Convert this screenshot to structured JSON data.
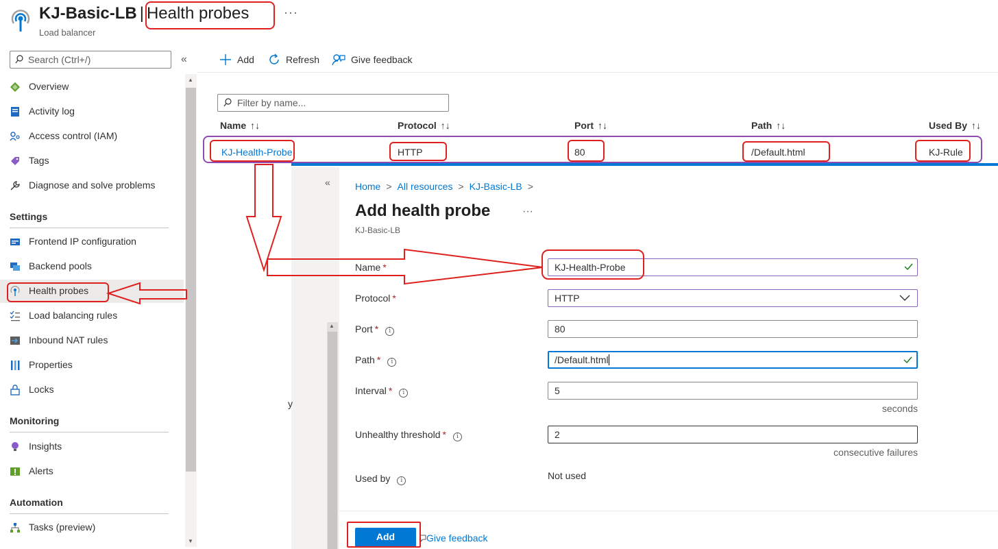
{
  "header": {
    "resource_name": "KJ-Basic-LB",
    "separator": "|",
    "page_name": "Health probes",
    "resource_type": "Load balancer",
    "more": "···"
  },
  "nav": {
    "search_placeholder": "Search (Ctrl+/)",
    "collapse": "«",
    "items": [
      {
        "label": "Overview",
        "icon": "overview-icon"
      },
      {
        "label": "Activity log",
        "icon": "activity-log-icon"
      },
      {
        "label": "Access control (IAM)",
        "icon": "iam-icon"
      },
      {
        "label": "Tags",
        "icon": "tag-icon"
      },
      {
        "label": "Diagnose and solve problems",
        "icon": "wrench-icon"
      }
    ],
    "settings_header": "Settings",
    "settings_items": [
      {
        "label": "Frontend IP configuration",
        "icon": "frontend-ip-icon"
      },
      {
        "label": "Backend pools",
        "icon": "backend-pool-icon"
      },
      {
        "label": "Health probes",
        "icon": "health-probe-icon",
        "selected": true
      },
      {
        "label": "Load balancing rules",
        "icon": "lb-rules-icon"
      },
      {
        "label": "Inbound NAT rules",
        "icon": "nat-rules-icon"
      },
      {
        "label": "Properties",
        "icon": "properties-icon"
      },
      {
        "label": "Locks",
        "icon": "lock-icon"
      }
    ],
    "monitoring_header": "Monitoring",
    "monitoring_items": [
      {
        "label": "Insights",
        "icon": "insights-icon"
      },
      {
        "label": "Alerts",
        "icon": "alerts-icon"
      }
    ],
    "automation_header": "Automation",
    "automation_items": [
      {
        "label": "Tasks (preview)",
        "icon": "tasks-icon"
      }
    ]
  },
  "toolbar": {
    "add": "Add",
    "refresh": "Refresh",
    "feedback": "Give feedback"
  },
  "table": {
    "filter_placeholder": "Filter by name...",
    "sort_glyph": "↑↓",
    "columns": [
      "Name",
      "Protocol",
      "Port",
      "Path",
      "Used By"
    ],
    "rows": [
      {
        "name": "KJ-Health-Probe",
        "protocol": "HTTP",
        "port": "80",
        "path": "/Default.html",
        "used_by": "KJ-Rule"
      }
    ]
  },
  "blade": {
    "collapse": "«",
    "ghost_text": "y",
    "breadcrumb": [
      "Home",
      "All resources",
      "KJ-Basic-LB"
    ],
    "breadcrumb_sep": ">",
    "title": "Add health probe",
    "more": "···",
    "subtitle": "KJ-Basic-LB",
    "required_mark": "*",
    "info_glyph": "i",
    "form": {
      "name_label": "Name",
      "name_value": "KJ-Health-Probe",
      "protocol_label": "Protocol",
      "protocol_value": "HTTP",
      "port_label": "Port",
      "port_value": "80",
      "path_label": "Path",
      "path_value": "/Default.html",
      "interval_label": "Interval",
      "interval_value": "5",
      "interval_unit": "seconds",
      "threshold_label": "Unhealthy threshold",
      "threshold_value": "2",
      "threshold_unit": "consecutive failures",
      "usedby_label": "Used by",
      "usedby_value": "Not used"
    },
    "add_button": "Add",
    "feedback": "Give feedback"
  },
  "colors": {
    "accent": "#0078d4",
    "annotation_red": "#e0201e",
    "annotation_purple": "#8f4bb0",
    "valid_green": "#107c10"
  }
}
